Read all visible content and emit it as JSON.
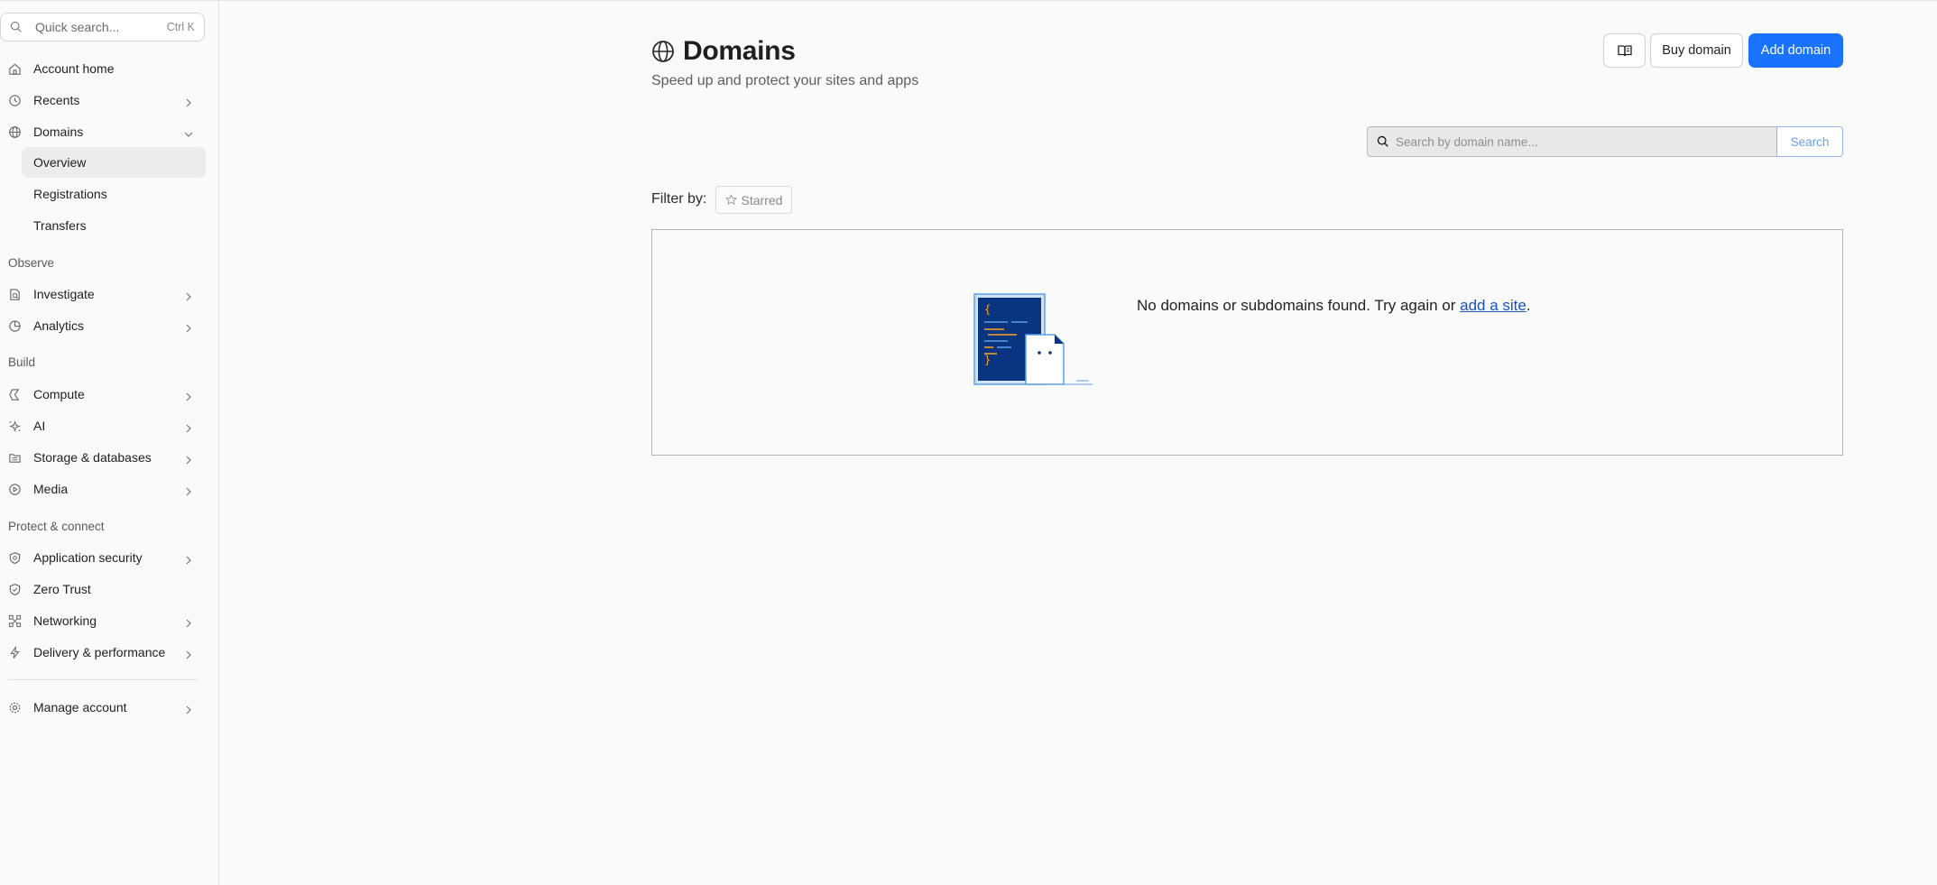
{
  "sidebar": {
    "quick_search": {
      "placeholder": "Quick search...",
      "shortcut": "Ctrl K"
    },
    "items": {
      "account_home": "Account home",
      "recents": "Recents",
      "domains": "Domains",
      "overview": "Overview",
      "registrations": "Registrations",
      "transfers": "Transfers",
      "investigate": "Investigate",
      "analytics": "Analytics",
      "compute": "Compute",
      "ai": "AI",
      "storage": "Storage & databases",
      "media": "Media",
      "app_security": "Application security",
      "zero_trust": "Zero Trust",
      "networking": "Networking",
      "delivery": "Delivery & performance",
      "manage_account": "Manage account"
    },
    "sections": {
      "observe": "Observe",
      "build": "Build",
      "protect": "Protect & connect"
    }
  },
  "header": {
    "title": "Domains",
    "subtitle": "Speed up and protect your sites and apps",
    "buy_label": "Buy domain",
    "add_label": "Add domain"
  },
  "search": {
    "placeholder": "Search by domain name...",
    "button_label": "Search"
  },
  "filter": {
    "label": "Filter by:",
    "starred_label": "Starred"
  },
  "empty": {
    "message": "No domains or subdomains found. Try again or ",
    "link_text": "add a site",
    "suffix": "."
  },
  "colors": {
    "accent": "#1a73ff",
    "link": "#1554c0",
    "illustration_dark": "#0a3480",
    "illustration_light": "#5aa0e8"
  }
}
